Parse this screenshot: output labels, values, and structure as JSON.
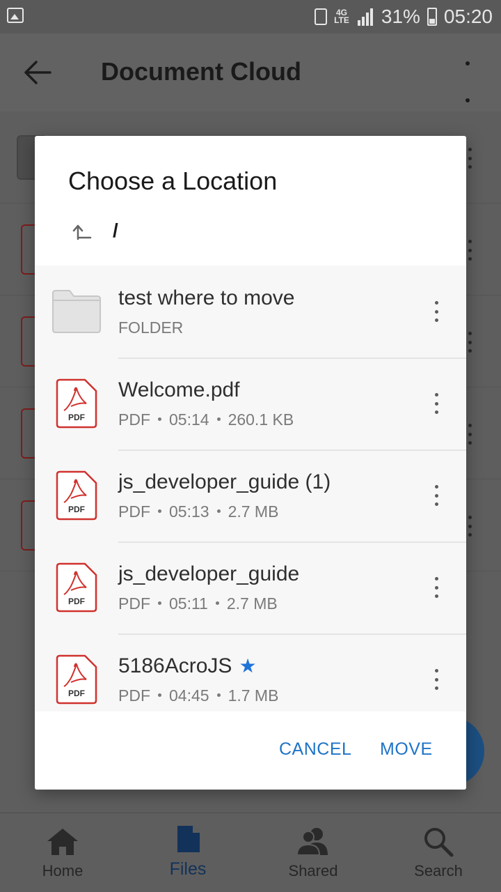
{
  "status_bar": {
    "battery": "31%",
    "time": "05:20",
    "network": "4G LTE",
    "icons": [
      "image-icon",
      "recycle-icon",
      "lte-icon",
      "signal-icon",
      "battery-icon"
    ]
  },
  "app_bar": {
    "title": "Document Cloud",
    "icons": [
      "back-arrow-icon",
      "more-vert-icon"
    ]
  },
  "dialog": {
    "title": "Choose a Location",
    "path": "/",
    "items": [
      {
        "name": "test where to move",
        "type": "FOLDER",
        "icon": "folder-icon"
      },
      {
        "name": "Welcome.pdf",
        "type": "PDF",
        "time": "05:14",
        "size": "260.1 KB",
        "icon": "pdf-icon",
        "icon_label": "PDF"
      },
      {
        "name": "js_developer_guide (1)",
        "type": "PDF",
        "time": "05:13",
        "size": "2.7 MB",
        "icon": "pdf-icon",
        "icon_label": "PDF"
      },
      {
        "name": "js_developer_guide",
        "type": "PDF",
        "time": "05:11",
        "size": "2.7 MB",
        "icon": "pdf-icon",
        "icon_label": "PDF"
      },
      {
        "name": "5186AcroJS",
        "type": "PDF",
        "time": "04:45",
        "size": "1.7 MB",
        "icon": "pdf-icon",
        "icon_label": "PDF",
        "starred": true,
        "star": "★"
      }
    ],
    "cancel_label": "CANCEL",
    "move_label": "MOVE"
  },
  "bottom_nav": {
    "items": [
      {
        "label": "Home",
        "icon": "home-icon"
      },
      {
        "label": "Files",
        "icon": "files-icon",
        "active": true
      },
      {
        "label": "Shared",
        "icon": "shared-icon"
      },
      {
        "label": "Search",
        "icon": "search-icon"
      }
    ]
  },
  "colors": {
    "accent": "#1e73c8",
    "pdf_red": "#d0322e",
    "scrim": "#5e5e5e",
    "active_nav": "#12325a"
  }
}
